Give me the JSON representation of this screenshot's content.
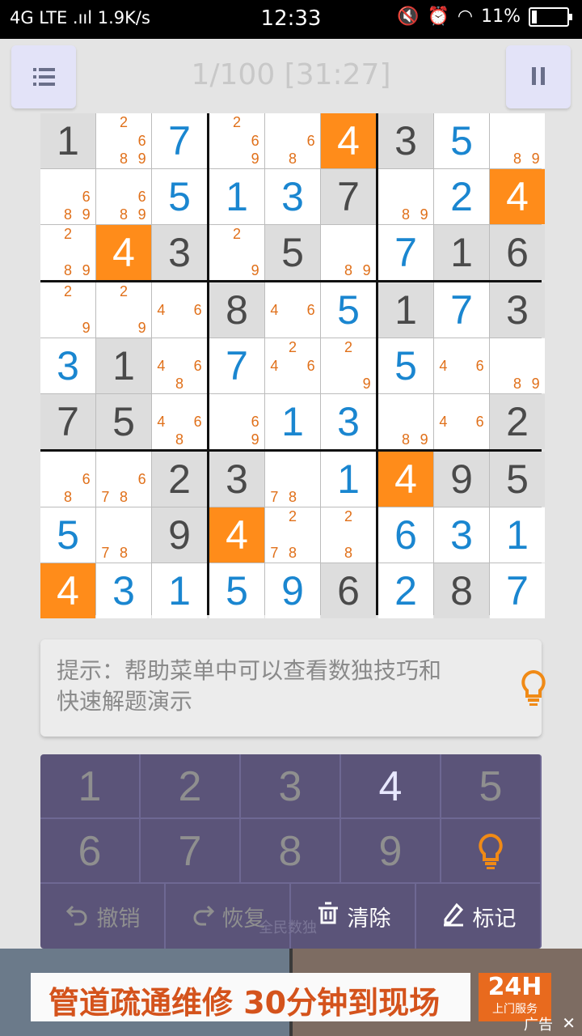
{
  "status_bar": {
    "left": "4G LTE .ııl 1.9K/s",
    "time": "12:33",
    "battery": "11%"
  },
  "header": {
    "title": "1/100 [31:27]",
    "menu_icon": "list-icon",
    "pause_icon": "pause-icon"
  },
  "colors": {
    "given": "#4a4a4a",
    "entered": "#1a86d0",
    "candidate": "#e0701a",
    "highlight": "#ff8c1a",
    "given_bg": "#dddddd"
  },
  "board": {
    "cells": [
      [
        {
          "v": "1",
          "t": "g"
        },
        {
          "c": [
            "2",
            "6",
            "8",
            "9"
          ]
        },
        {
          "v": "7",
          "t": "u"
        },
        {
          "c": [
            "2",
            "6",
            "9"
          ]
        },
        {
          "c": [
            "6",
            "8"
          ]
        },
        {
          "v": "4",
          "t": "h"
        },
        {
          "v": "3",
          "t": "g"
        },
        {
          "v": "5",
          "t": "u"
        },
        {
          "c": [
            "8",
            "9"
          ]
        }
      ],
      [
        {
          "c": [
            "6",
            "8",
            "9"
          ]
        },
        {
          "c": [
            "6",
            "8",
            "9"
          ]
        },
        {
          "v": "5",
          "t": "u"
        },
        {
          "v": "1",
          "t": "u"
        },
        {
          "v": "3",
          "t": "u"
        },
        {
          "v": "7",
          "t": "g"
        },
        {
          "c": [
            "8",
            "9"
          ]
        },
        {
          "v": "2",
          "t": "u"
        },
        {
          "v": "4",
          "t": "h"
        }
      ],
      [
        {
          "c": [
            "2",
            "8",
            "9"
          ]
        },
        {
          "v": "4",
          "t": "h"
        },
        {
          "v": "3",
          "t": "g"
        },
        {
          "c": [
            "2",
            "9"
          ]
        },
        {
          "v": "5",
          "t": "g"
        },
        {
          "c": [
            "8",
            "9"
          ]
        },
        {
          "v": "7",
          "t": "u"
        },
        {
          "v": "1",
          "t": "g"
        },
        {
          "v": "6",
          "t": "g"
        }
      ],
      [
        {
          "c": [
            "2",
            "9"
          ]
        },
        {
          "c": [
            "2",
            "9"
          ]
        },
        {
          "c": [
            "4",
            "6"
          ]
        },
        {
          "v": "8",
          "t": "g"
        },
        {
          "c": [
            "4",
            "6"
          ]
        },
        {
          "v": "5",
          "t": "u"
        },
        {
          "v": "1",
          "t": "g"
        },
        {
          "v": "7",
          "t": "u"
        },
        {
          "v": "3",
          "t": "g"
        }
      ],
      [
        {
          "v": "3",
          "t": "u"
        },
        {
          "v": "1",
          "t": "g"
        },
        {
          "c": [
            "4",
            "6",
            "8"
          ]
        },
        {
          "v": "7",
          "t": "u"
        },
        {
          "c": [
            "2",
            "4",
            "6"
          ]
        },
        {
          "c": [
            "2",
            "9"
          ]
        },
        {
          "v": "5",
          "t": "u"
        },
        {
          "c": [
            "4",
            "6"
          ]
        },
        {
          "c": [
            "8",
            "9"
          ]
        }
      ],
      [
        {
          "v": "7",
          "t": "g"
        },
        {
          "v": "5",
          "t": "g"
        },
        {
          "c": [
            "4",
            "6",
            "8"
          ]
        },
        {
          "c": [
            "6",
            "9"
          ]
        },
        {
          "v": "1",
          "t": "u"
        },
        {
          "v": "3",
          "t": "u"
        },
        {
          "c": [
            "8",
            "9"
          ]
        },
        {
          "c": [
            "4",
            "6"
          ]
        },
        {
          "v": "2",
          "t": "g"
        }
      ],
      [
        {
          "c": [
            "6",
            "8"
          ]
        },
        {
          "c": [
            "6",
            "7",
            "8"
          ]
        },
        {
          "v": "2",
          "t": "g"
        },
        {
          "v": "3",
          "t": "g"
        },
        {
          "c": [
            "7",
            "8"
          ]
        },
        {
          "v": "1",
          "t": "u"
        },
        {
          "v": "4",
          "t": "h"
        },
        {
          "v": "9",
          "t": "g"
        },
        {
          "v": "5",
          "t": "g"
        }
      ],
      [
        {
          "v": "5",
          "t": "u"
        },
        {
          "c": [
            "7",
            "8"
          ]
        },
        {
          "v": "9",
          "t": "g"
        },
        {
          "v": "4",
          "t": "h"
        },
        {
          "c": [
            "2",
            "7",
            "8"
          ]
        },
        {
          "c": [
            "2",
            "8"
          ]
        },
        {
          "v": "6",
          "t": "u"
        },
        {
          "v": "3",
          "t": "u"
        },
        {
          "v": "1",
          "t": "u"
        }
      ],
      [
        {
          "v": "4",
          "t": "h"
        },
        {
          "v": "3",
          "t": "u"
        },
        {
          "v": "1",
          "t": "u"
        },
        {
          "v": "5",
          "t": "u"
        },
        {
          "v": "9",
          "t": "u"
        },
        {
          "v": "6",
          "t": "g"
        },
        {
          "v": "2",
          "t": "u"
        },
        {
          "v": "8",
          "t": "g"
        },
        {
          "v": "7",
          "t": "u"
        }
      ]
    ]
  },
  "hint": {
    "text": "提示：帮助菜单中可以查看数独技巧和快速解题演示",
    "icon": "lightbulb-icon"
  },
  "keypad": {
    "digits": [
      "1",
      "2",
      "3",
      "4",
      "5",
      "6",
      "7",
      "8",
      "9"
    ],
    "active_digit": "4",
    "hint_icon": "lightbulb-icon",
    "actions": [
      {
        "label": "撤销",
        "icon": "undo-icon",
        "enabled": false
      },
      {
        "label": "恢复",
        "icon": "redo-icon",
        "enabled": false
      },
      {
        "label": "清除",
        "icon": "trash-icon",
        "enabled": true
      },
      {
        "label": "标记",
        "icon": "pencil-icon",
        "enabled": true
      }
    ],
    "watermark": "全民数独"
  },
  "ad": {
    "slogan": "管道疏通维修 30分钟到现场",
    "tag_big": "24H",
    "tag_small": "上门服务",
    "label": "广告",
    "close": "✕"
  }
}
